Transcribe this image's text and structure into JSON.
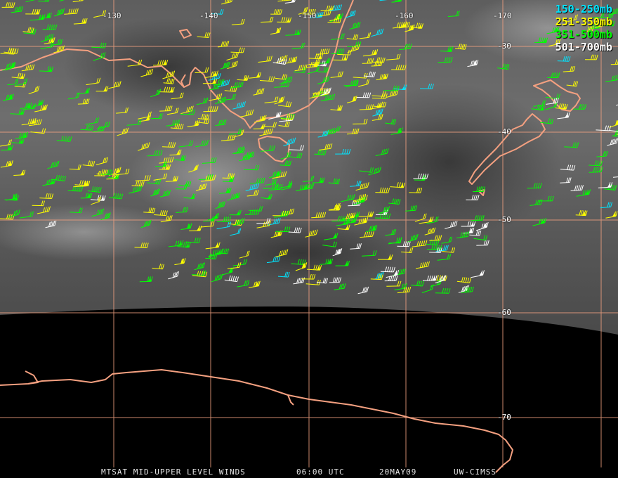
{
  "map": {
    "longitude_labels": [
      "-130",
      "-140",
      "-150",
      "-160",
      "-170"
    ],
    "latitude_labels": [
      "-30",
      "-40",
      "-50",
      "-60",
      "-70"
    ],
    "grid_color": "#f0a080",
    "coast_color": "#f4a080"
  },
  "legend": [
    {
      "label": "150-250mb",
      "color": "#00e5ff"
    },
    {
      "label": "251-350mb",
      "color": "#ffff00"
    },
    {
      "label": "351-500mb",
      "color": "#00ff00"
    },
    {
      "label": "501-700mb",
      "color": "#ffffff"
    }
  ],
  "footer": {
    "product": "MTSAT MID-UPPER LEVEL WINDS",
    "time": "06:00 UTC",
    "date": "20MAY09",
    "source": "UW-CIMSS"
  }
}
